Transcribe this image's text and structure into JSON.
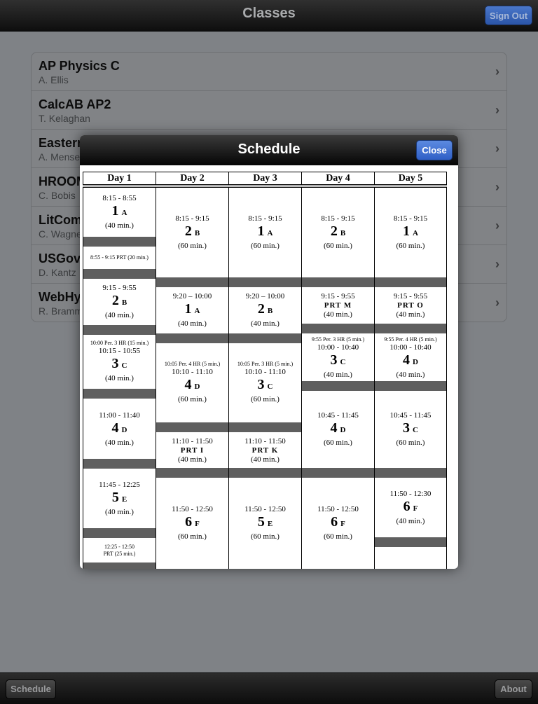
{
  "nav": {
    "title": "Classes",
    "signout_label": "Sign Out"
  },
  "classes": [
    {
      "title": "AP Physics C",
      "teacher": "A. Ellis"
    },
    {
      "title": "CalcAB AP2",
      "teacher": "T. Kelaghan"
    },
    {
      "title": "Eastern",
      "teacher": "A. Mense"
    },
    {
      "title": "HROOM",
      "teacher": "C. Bobis"
    },
    {
      "title": "LitCom",
      "teacher": "C. Wagne"
    },
    {
      "title": "USGov",
      "teacher": "D. Kantz"
    },
    {
      "title": "WebHy",
      "teacher": "R. Bramm"
    }
  ],
  "modal": {
    "title": "Schedule",
    "close_label": "Close"
  },
  "schedule": {
    "days": [
      "Day 1",
      "Day 2",
      "Day 3",
      "Day 4",
      "Day 5"
    ],
    "columns": [
      [
        {
          "time": "8:15 - 8:55",
          "period": "1",
          "letter": "A",
          "dur": "(40 min.)"
        },
        {
          "line": "8:55 - 9:15 PRT (20 min.)"
        },
        {
          "time": "9:15 - 9:55",
          "period": "2",
          "letter": "B",
          "dur": "(40 min.)"
        },
        {
          "tiny": "10:00 Per. 3 HR (15 min.)",
          "time": "10:15 - 10:55",
          "period": "3",
          "letter": "C",
          "dur": "(40 min.)"
        },
        {
          "time": "11:00 - 11:40",
          "period": "4",
          "letter": "D",
          "dur": "(40 min.)"
        },
        {
          "time": "11:45 - 12:25",
          "period": "5",
          "letter": "E",
          "dur": "(40 min.)"
        },
        {
          "tiny": "12:25 - 12:50",
          "tiny2": "PRT (25 min.)"
        }
      ],
      [
        {
          "time": "8:15 - 9:15",
          "period": "2",
          "letter": "B",
          "dur": "(60 min.)"
        },
        {
          "time": "9:20 – 10:00",
          "period": "1",
          "letter": "A",
          "dur": "(40 min.)"
        },
        {
          "tiny": "10:05 Per. 4 HR (5 min.)",
          "time": "10:10 - 11:10",
          "period": "4",
          "letter": "D",
          "dur": "(60 min.)"
        },
        {
          "time": "11:10 - 11:50",
          "prt": "PRT I",
          "dur": "(40 min.)"
        },
        {
          "time": "11:50 - 12:50",
          "period": "6",
          "letter": "F",
          "dur": "(60 min.)"
        }
      ],
      [
        {
          "time": "8:15 - 9:15",
          "period": "1",
          "letter": "A",
          "dur": "(60 min.)"
        },
        {
          "time": "9:20 – 10:00",
          "period": "2",
          "letter": "B",
          "dur": "(40 min.)"
        },
        {
          "tiny": "10:05 Per. 3 HR (5 min.)",
          "time": "10:10 - 11:10",
          "period": "3",
          "letter": "C",
          "dur": "(60 min.)"
        },
        {
          "time": "11:10 - 11:50",
          "prt": "PRT K",
          "dur": "(40 min.)"
        },
        {
          "time": "11:50 - 12:50",
          "period": "5",
          "letter": "E",
          "dur": "(60 min.)"
        }
      ],
      [
        {
          "time": "8:15 - 9:15",
          "period": "2",
          "letter": "B",
          "dur": "(60 min.)"
        },
        {
          "time": "9:15 - 9:55",
          "prt": "PRT M",
          "dur": "(40 min.)"
        },
        {
          "tiny": "9:55 Per. 3 HR (5 min.)",
          "time": "10:00 - 10:40",
          "period": "3",
          "letter": "C",
          "dur": "(40 min.)"
        },
        {
          "time": "10:45 - 11:45",
          "period": "4",
          "letter": "D",
          "dur": "(60 min.)"
        },
        {
          "time": "11:50 - 12:50",
          "period": "6",
          "letter": "F",
          "dur": "(60 min.)"
        }
      ],
      [
        {
          "time": "8:15 - 9:15",
          "period": "1",
          "letter": "A",
          "dur": "(60 min.)"
        },
        {
          "time": "9:15 - 9:55",
          "prt": "PRT O",
          "dur": "(40 min.)"
        },
        {
          "tiny": "9:55 Per. 4 HR (5 min.)",
          "time": "10:00 - 10:40",
          "period": "4",
          "letter": "D",
          "dur": "(40 min.)"
        },
        {
          "time": "10:45 - 11:45",
          "period": "3",
          "letter": "C",
          "dur": "(60 min.)"
        },
        {
          "time": "11:50 - 12:30",
          "period": "6",
          "letter": "F",
          "dur": "(40 min.)"
        }
      ]
    ]
  },
  "tabbar": {
    "schedule_label": "Schedule",
    "about_label": "About"
  }
}
